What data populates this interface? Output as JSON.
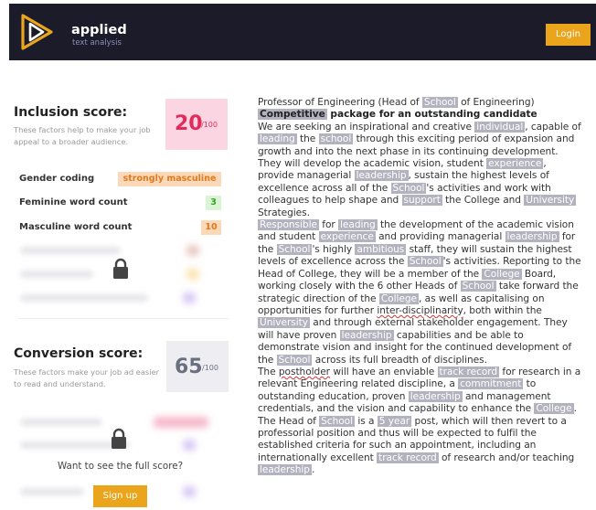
{
  "header": {
    "brand": "applied",
    "brand_sub": "text analysis",
    "login_label": "Login"
  },
  "inclusion": {
    "title": "Inclusion score:",
    "description": "These factors help to make your job appeal to a broader audience.",
    "score": "20",
    "max": "/100",
    "rows": [
      {
        "label": "Gender coding",
        "value": "strongly masculine"
      },
      {
        "label": "Feminine word count",
        "value": "3"
      },
      {
        "label": "Masculine word count",
        "value": "10"
      }
    ]
  },
  "conversion": {
    "title": "Conversion score:",
    "description": "These factors make your job ad easier to read and understand.",
    "score": "65",
    "max": "/100"
  },
  "cta": {
    "prompt": "Want to see the full score?",
    "signup_label": "Sign up"
  },
  "colors": {
    "header_bg": "#1b1b29",
    "accent": "#eba51c",
    "inclusion_score": "#df2b5e",
    "masculine": "#e0791f",
    "feminine": "#3b9f2b",
    "highlight": "#b3b3bf"
  },
  "icons": [
    "logo-mark",
    "lock-icon"
  ],
  "document": {
    "segments": [
      {
        "t": "Professor of Engineering (Head of "
      },
      {
        "t": "School",
        "hl": true
      },
      {
        "t": " of Engineering)"
      },
      {
        "br": true
      },
      {
        "t": "Competitive",
        "hl": true,
        "b": true
      },
      {
        "t": " package for an outstanding candidate",
        "b": true
      },
      {
        "br": true
      },
      {
        "t": "We are seeking an inspirational and creative "
      },
      {
        "t": "individual",
        "hl": true
      },
      {
        "t": ", capable of "
      },
      {
        "t": "leading",
        "hl": true
      },
      {
        "t": " the "
      },
      {
        "t": "school",
        "hl": true
      },
      {
        "t": " through this exciting period of expansion and growth  and into the next phase in its continuing development. They will develop  the academic vision, student "
      },
      {
        "t": "experience",
        "hl": true
      },
      {
        "t": ", provide managerial "
      },
      {
        "t": "leadership",
        "hl": true
      },
      {
        "t": ", sustain the highest levels of excellence across all of the "
      },
      {
        "t": "School",
        "hl": true
      },
      {
        "t": "'s activities and work with colleagues to help shape and "
      },
      {
        "t": "support",
        "hl": true
      },
      {
        "t": " the  College and "
      },
      {
        "t": "University",
        "hl": true
      },
      {
        "t": " Strategies."
      },
      {
        "br": true
      },
      {
        "t": "Responsible",
        "hl": true
      },
      {
        "t": " for "
      },
      {
        "t": "leading",
        "hl": true
      },
      {
        "t": " the development of the academic vision and  student "
      },
      {
        "t": "experience",
        "hl": true
      },
      {
        "t": " and providing managerial "
      },
      {
        "t": "leadership",
        "hl": true
      },
      {
        "t": " for the "
      },
      {
        "t": "School",
        "hl": true
      },
      {
        "t": "'s  highly "
      },
      {
        "t": "ambitious",
        "hl": true
      },
      {
        "t": " staff, they will sustain the highest levels of  excellence across the "
      },
      {
        "t": "School",
        "hl": true
      },
      {
        "t": "'s activities. Reporting to the Head of  College, they will be a member of the "
      },
      {
        "t": "College",
        "hl": true
      },
      {
        "t": " Board, working closely  with the 6 other Heads of "
      },
      {
        "t": "School",
        "hl": true
      },
      {
        "t": " take forward the strategic direction of  the "
      },
      {
        "t": "College",
        "hl": true
      },
      {
        "t": ", as well as capitalising on opportunities for further  "
      },
      {
        "t": "inter-disciplinarity",
        "ul": true
      },
      {
        "t": ", both within the "
      },
      {
        "t": "University",
        "hl": true
      },
      {
        "t": " and through external  stakeholder engagement.  They will have proven "
      },
      {
        "t": "leadership",
        "hl": true
      },
      {
        "t": "  capabilities  and  be  able  to demonstrate  vision and  insight  for   the  continued development of the "
      },
      {
        "t": "School",
        "hl": true
      },
      {
        "t": " across its full breadth of  disciplines."
      },
      {
        "br": true
      },
      {
        "t": "The "
      },
      {
        "t": "postholder",
        "ul": true
      },
      {
        "t": " will have an enviable "
      },
      {
        "t": "track record",
        "hl": true
      },
      {
        "t": " for research in a relevant Engineering related discipline, a "
      },
      {
        "t": "commitment",
        "hl": true
      },
      {
        "t": " to outstanding  education, proven "
      },
      {
        "t": "leadership",
        "hl": true
      },
      {
        "t": " and management credentials, and the vision  and capability to enhance the "
      },
      {
        "t": "College",
        "hl": true
      },
      {
        "t": ". The Head of "
      },
      {
        "t": "School",
        "hl": true
      },
      {
        "t": " is a "
      },
      {
        "t": "5 year",
        "hl": true
      },
      {
        "t": "  post, which will then revert to a professorial position and thus will be  expected to fulfil the established criteria for such an appointment,  including an internationally excellent "
      },
      {
        "t": "track record",
        "hl": true
      },
      {
        "t": " of research and/or  teaching "
      },
      {
        "t": "leadership",
        "hl": true
      },
      {
        "t": "."
      }
    ]
  }
}
